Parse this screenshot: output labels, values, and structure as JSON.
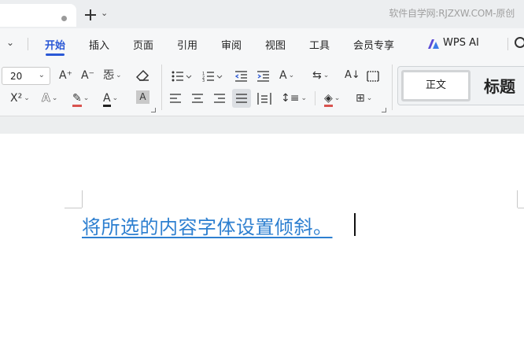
{
  "titlebar": {
    "watermark": "软件自学网:RJZXW.COM-原创",
    "new_tab_symbol": "+",
    "tab_menu_chevron": "⌄"
  },
  "menu": {
    "items": [
      {
        "label": "开始",
        "active": true
      },
      {
        "label": "插入"
      },
      {
        "label": "页面"
      },
      {
        "label": "引用"
      },
      {
        "label": "审阅"
      },
      {
        "label": "视图"
      },
      {
        "label": "工具"
      },
      {
        "label": "会员专享"
      },
      {
        "label": "WPS AI"
      }
    ],
    "accent_color": "#2a58d6"
  },
  "toolbar": {
    "font_size": "20",
    "increase_font": "A⁺",
    "decrease_font": "A⁻",
    "phonetic": "㤅",
    "superscript": "X²",
    "font_effect": "A",
    "highlight": "ab",
    "font_color": "A",
    "char_shading": "A",
    "text_direction": "A",
    "sort": "A↓"
  },
  "styles": {
    "normal": "正文",
    "title": "标题"
  },
  "document": {
    "text": "将所选的内容字体设置倾斜。",
    "text_color": "#2d7fd0"
  }
}
